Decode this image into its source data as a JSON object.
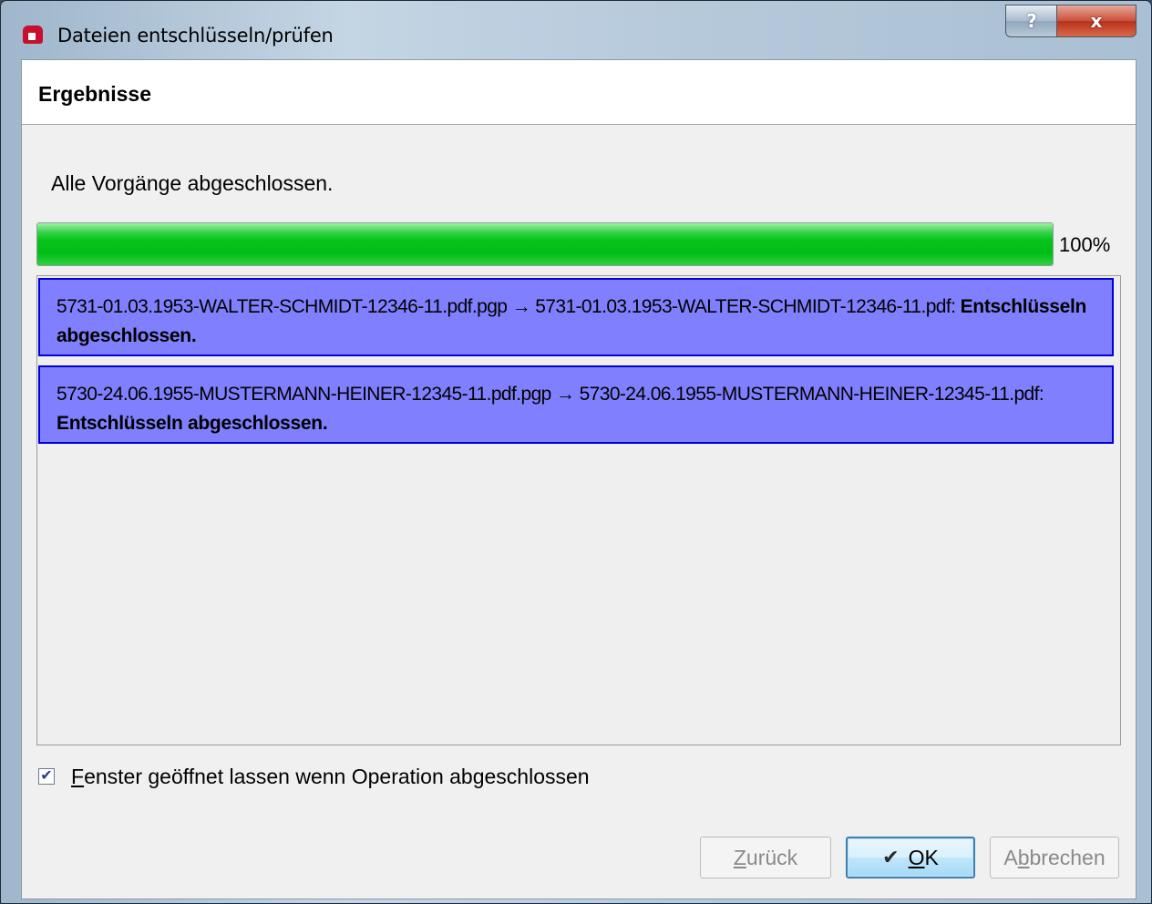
{
  "window": {
    "title": "Dateien entschlüsseln/prüfen",
    "help_label": "?",
    "close_label": "x"
  },
  "header": {
    "title": "Ergebnisse"
  },
  "status": {
    "message": "Alle Vorgänge abgeschlossen.",
    "progress_percent": 100,
    "progress_label": "100%"
  },
  "results": [
    {
      "text": "5731-01.03.1953-WALTER-SCHMIDT-12346-11.pdf.pgp → 5731-01.03.1953-WALTER-SCHMIDT-12346-11.pdf: ",
      "status": "Entschlüsseln abgeschlossen."
    },
    {
      "text": "5730-24.06.1955-MUSTERMANN-HEINER-12345-11.pdf.pgp → 5730-24.06.1955-MUSTERMANN-HEINER-12345-11.pdf: ",
      "status": "Entschlüsseln abgeschlossen."
    }
  ],
  "keep_open": {
    "mnemonic": "F",
    "label_rest": "enster geöffnet lassen wenn Operation abgeschlossen",
    "checked": true
  },
  "buttons": {
    "back": {
      "mnemonic": "Z",
      "rest": "urück",
      "enabled": false
    },
    "ok": {
      "icon": "checkmark-icon",
      "mnemonic": "O",
      "rest": "K",
      "enabled": true
    },
    "cancel": {
      "pre": "A",
      "mnemonic": "b",
      "rest": "brechen",
      "enabled": false
    }
  },
  "colors": {
    "progress_fill": "#00be16",
    "selection_bg": "#8080ff",
    "selection_border": "#0000d8"
  }
}
